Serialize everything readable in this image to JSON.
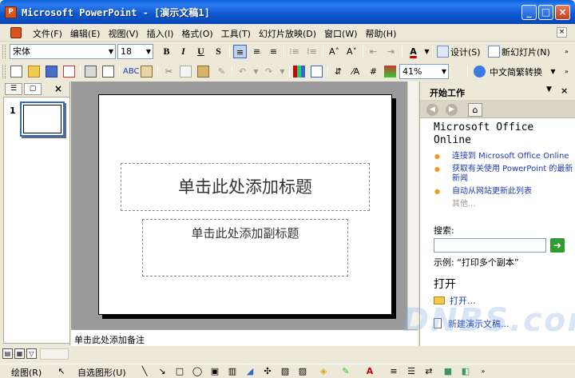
{
  "window": {
    "title": "Microsoft PowerPoint - [演示文稿1]",
    "controls": [
      "_",
      "□",
      "×"
    ]
  },
  "menu": {
    "items": [
      "文件(F)",
      "编辑(E)",
      "视图(V)",
      "插入(I)",
      "格式(O)",
      "工具(T)",
      "幻灯片放映(D)",
      "窗口(W)",
      "帮助(H)"
    ]
  },
  "format_toolbar": {
    "font": "宋体",
    "size": "18",
    "design_label": "设计(S)",
    "new_slide_label": "新幻灯片(N)"
  },
  "standard_toolbar": {
    "zoom": "41%",
    "convert_label": "中文简繁转换"
  },
  "slides_pane": {
    "slide_number": "1"
  },
  "slide": {
    "title_placeholder": "单击此处添加标题",
    "subtitle_placeholder": "单击此处添加副标题"
  },
  "notes": {
    "placeholder": "单击此处添加备注"
  },
  "task_pane": {
    "title": "开始工作",
    "office_online": "Microsoft Office Online",
    "links": [
      "连接到 Microsoft Office Online",
      "获取有关使用 PowerPoint 的最新新闻",
      "自动从网站更新此列表"
    ],
    "more": "其他...",
    "search_label": "搜索:",
    "search_value": "",
    "example": "示例:  “打印多个副本”",
    "open_heading": "打开",
    "open_item": "打开...",
    "new_item": "新建演示文稿..."
  },
  "draw_toolbar": {
    "draw_label": "绘图(R)",
    "autoshapes_label": "自选图形(U)"
  },
  "watermark": "DNBS.com",
  "colors": {
    "titlebar": "#0a5fd8",
    "workspace": "#9a9a9a",
    "accent_bullet": "#f09a12",
    "link": "#1c3ab5"
  }
}
